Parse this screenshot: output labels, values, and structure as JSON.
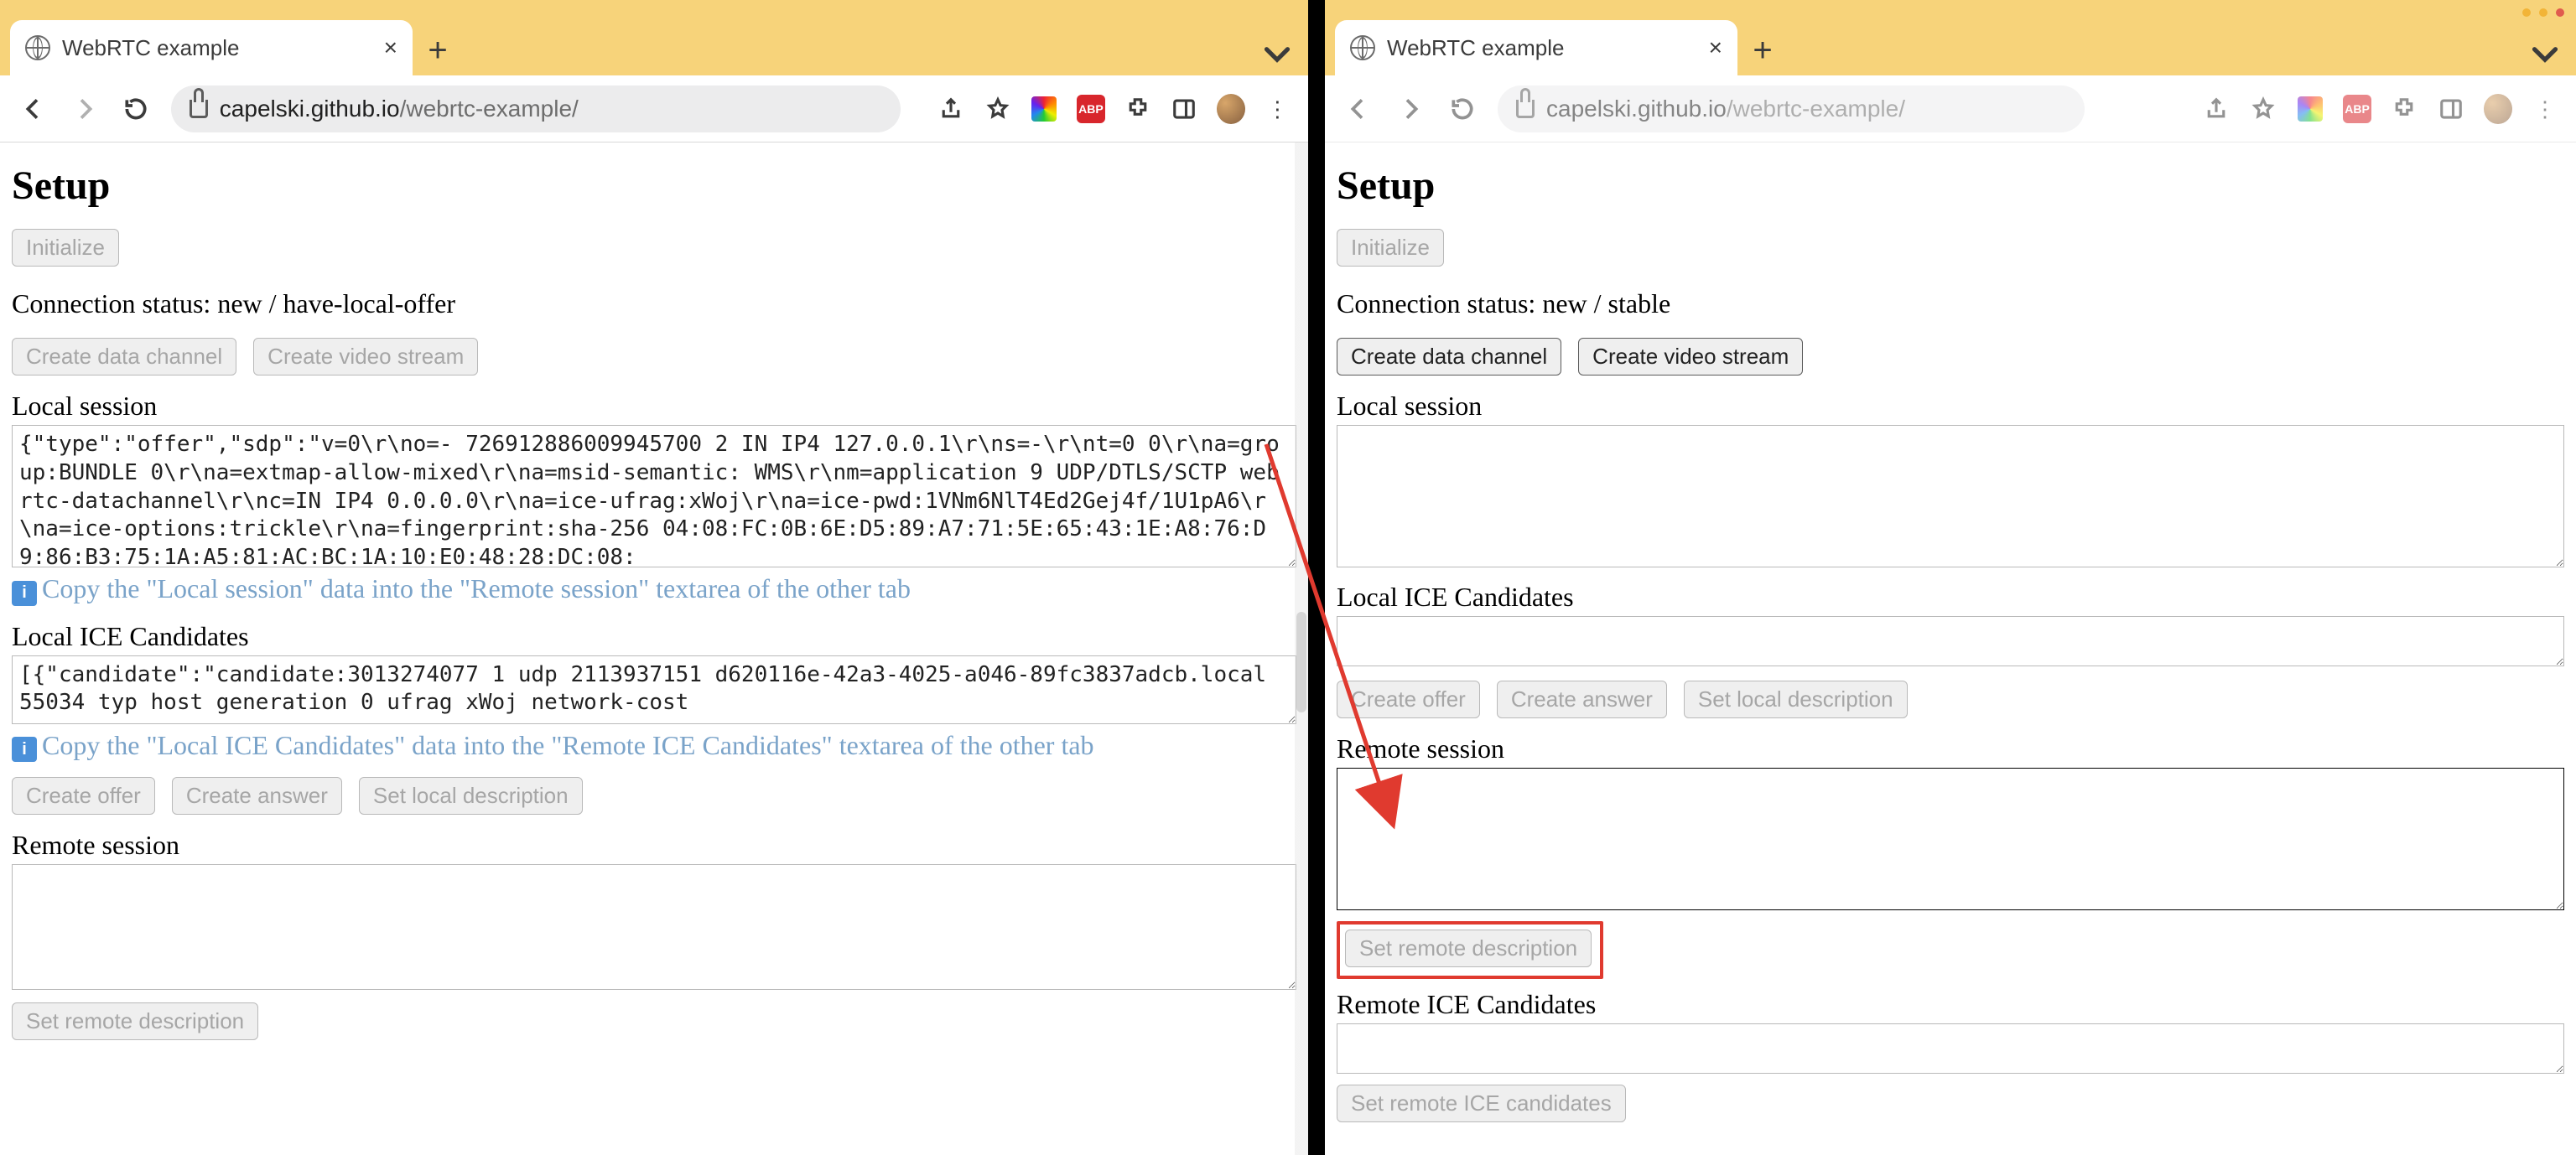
{
  "browser": {
    "tab_title": "WebRTC example",
    "url_host": "capelski.github.io",
    "url_path": "/webrtc-example/"
  },
  "shared": {
    "page_title": "Setup",
    "initialize": "Initialize",
    "create_data_channel": "Create data channel",
    "create_video_stream": "Create video stream",
    "local_session": "Local session",
    "local_ice": "Local ICE Candidates",
    "create_offer": "Create offer",
    "create_answer": "Create answer",
    "set_local_desc": "Set local description",
    "remote_session": "Remote session",
    "set_remote_desc": "Set remote description",
    "remote_ice": "Remote ICE Candidates",
    "set_remote_ice": "Set remote ICE candidates",
    "status_prefix": "Connection status: "
  },
  "left": {
    "status_value": "new / have-local-offer",
    "local_session_value": "{\"type\":\"offer\",\"sdp\":\"v=0\\r\\no=- 726912886009945700 2 IN IP4 127.0.0.1\\r\\ns=-\\r\\nt=0 0\\r\\na=group:BUNDLE 0\\r\\na=extmap-allow-mixed\\r\\na=msid-semantic: WMS\\r\\nm=application 9 UDP/DTLS/SCTP webrtc-datachannel\\r\\nc=IN IP4 0.0.0.0\\r\\na=ice-ufrag:xWoj\\r\\na=ice-pwd:1VNm6NlT4Ed2Gej4f/1U1pA6\\r\\na=ice-options:trickle\\r\\na=fingerprint:sha-256 04:08:FC:0B:6E:D5:89:A7:71:5E:65:43:1E:A8:76:D9:86:B3:75:1A:A5:81:AC:BC:1A:10:E0:48:28:DC:08:",
    "hint_session": "Copy the \"Local session\" data into the \"Remote session\" textarea of the other tab",
    "local_ice_value": "[{\"candidate\":\"candidate:3013274077 1 udp 2113937151 d620116e-42a3-4025-a046-89fc3837adcb.local 55034 typ host generation 0 ufrag xWoj network-cost",
    "hint_ice": "Copy the \"Local ICE Candidates\" data into the \"Remote ICE Candidates\" textarea of the other tab"
  },
  "right": {
    "status_value": "new / stable"
  }
}
